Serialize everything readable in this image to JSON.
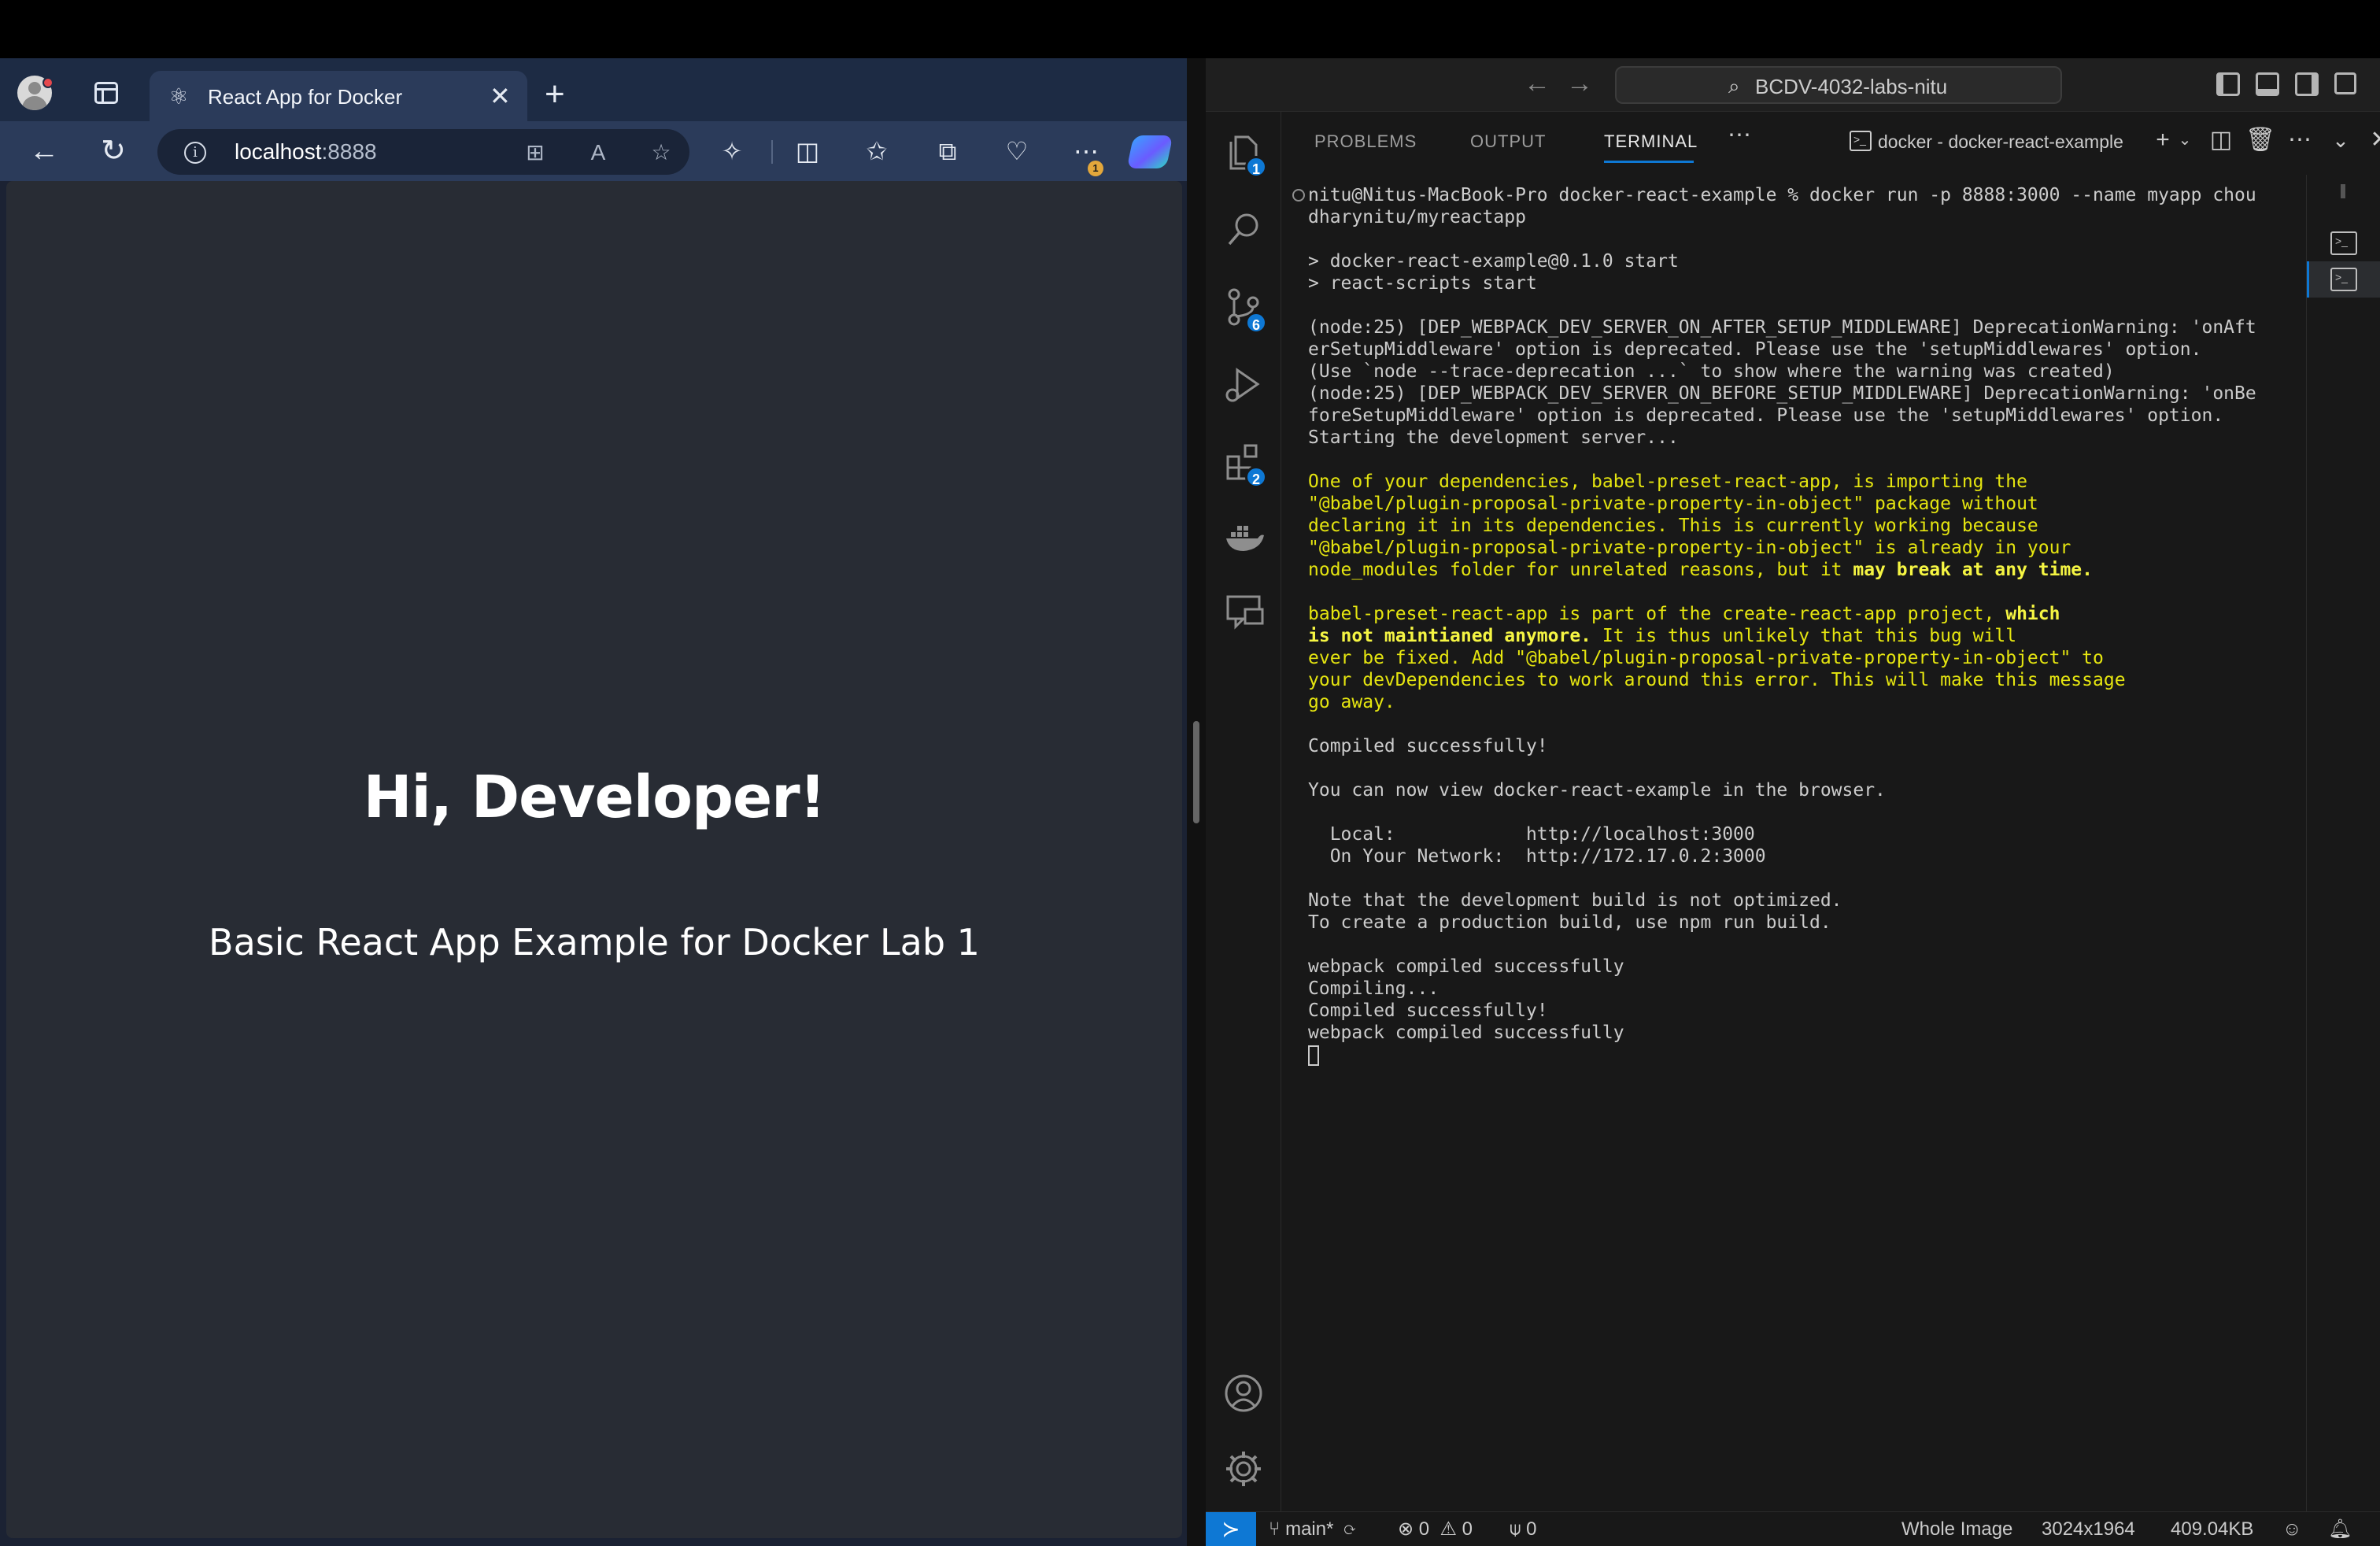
{
  "browser": {
    "tab_title": "React App for Docker",
    "url_host": "localhost",
    "url_port": ":8888",
    "extensions_badge": "1",
    "page": {
      "heading": "Hi, Developer!",
      "subtitle": "Basic React App Example for Docker Lab 1"
    }
  },
  "vscode": {
    "search_text": "BCDV-4032-labs-nitu",
    "activity_badges": {
      "explorer": "1",
      "source_control": "6",
      "extensions": "2"
    },
    "panel_tabs": [
      "PROBLEMS",
      "OUTPUT",
      "TERMINAL"
    ],
    "terminal_name": "docker - docker-react-example",
    "terminal_lines": [
      {
        "t": "nitu@Nitus-MacBook-Pro docker-react-example % docker run -p 8888:3000 --name myapp chou",
        "c": ""
      },
      {
        "t": "dharynitu/myreactapp",
        "c": ""
      },
      {
        "t": "",
        "c": ""
      },
      {
        "t": "> docker-react-example@0.1.0 start",
        "c": ""
      },
      {
        "t": "> react-scripts start",
        "c": ""
      },
      {
        "t": "",
        "c": ""
      },
      {
        "t": "(node:25) [DEP_WEBPACK_DEV_SERVER_ON_AFTER_SETUP_MIDDLEWARE] DeprecationWarning: 'onAft",
        "c": ""
      },
      {
        "t": "erSetupMiddleware' option is deprecated. Please use the 'setupMiddlewares' option.",
        "c": ""
      },
      {
        "t": "(Use `node --trace-deprecation ...` to show where the warning was created)",
        "c": ""
      },
      {
        "t": "(node:25) [DEP_WEBPACK_DEV_SERVER_ON_BEFORE_SETUP_MIDDLEWARE] DeprecationWarning: 'onBe",
        "c": ""
      },
      {
        "t": "foreSetupMiddleware' option is deprecated. Please use the 'setupMiddlewares' option.",
        "c": ""
      },
      {
        "t": "Starting the development server...",
        "c": ""
      },
      {
        "t": "",
        "c": ""
      },
      {
        "t": "One of your dependencies, babel-preset-react-app, is importing the",
        "c": "y"
      },
      {
        "t": "\"@babel/plugin-proposal-private-property-in-object\" package without",
        "c": "y"
      },
      {
        "t": "declaring it in its dependencies. This is currently working because",
        "c": "y"
      },
      {
        "t": "\"@babel/plugin-proposal-private-property-in-object\" is already in your",
        "c": "y"
      },
      {
        "t": "node_modules folder for unrelated reasons, but it ",
        "c": "y",
        "b": "may break at any time."
      },
      {
        "t": "",
        "c": ""
      },
      {
        "t": "babel-preset-react-app is part of the create-react-app project, ",
        "c": "y",
        "b": "which"
      },
      {
        "pre_b": "is not maintianed anymore.",
        "t": " It is thus unlikely that this bug will",
        "c": "y"
      },
      {
        "t": "ever be fixed. Add \"@babel/plugin-proposal-private-property-in-object\" to",
        "c": "y"
      },
      {
        "t": "your devDependencies to work around this error. This will make this message",
        "c": "y"
      },
      {
        "t": "go away.",
        "c": "y"
      },
      {
        "t": "",
        "c": ""
      },
      {
        "t": "Compiled successfully!",
        "c": ""
      },
      {
        "t": "",
        "c": ""
      },
      {
        "t": "You can now view docker-react-example in the browser.",
        "c": ""
      },
      {
        "t": "",
        "c": ""
      },
      {
        "t": "  Local:            http://localhost:3000",
        "c": ""
      },
      {
        "t": "  On Your Network:  http://172.17.0.2:3000",
        "c": ""
      },
      {
        "t": "",
        "c": ""
      },
      {
        "t": "Note that the development build is not optimized.",
        "c": ""
      },
      {
        "t": "To create a production build, use npm run build.",
        "c": ""
      },
      {
        "t": "",
        "c": ""
      },
      {
        "t": "webpack compiled successfully",
        "c": ""
      },
      {
        "t": "Compiling...",
        "c": ""
      },
      {
        "t": "Compiled successfully!",
        "c": ""
      },
      {
        "t": "webpack compiled successfully",
        "c": ""
      }
    ],
    "status": {
      "branch": "main*",
      "errors": "0",
      "warnings": "0",
      "ports": "0",
      "whole_image": "Whole Image",
      "dimensions": "3024x1964",
      "size": "409.04KB"
    }
  }
}
